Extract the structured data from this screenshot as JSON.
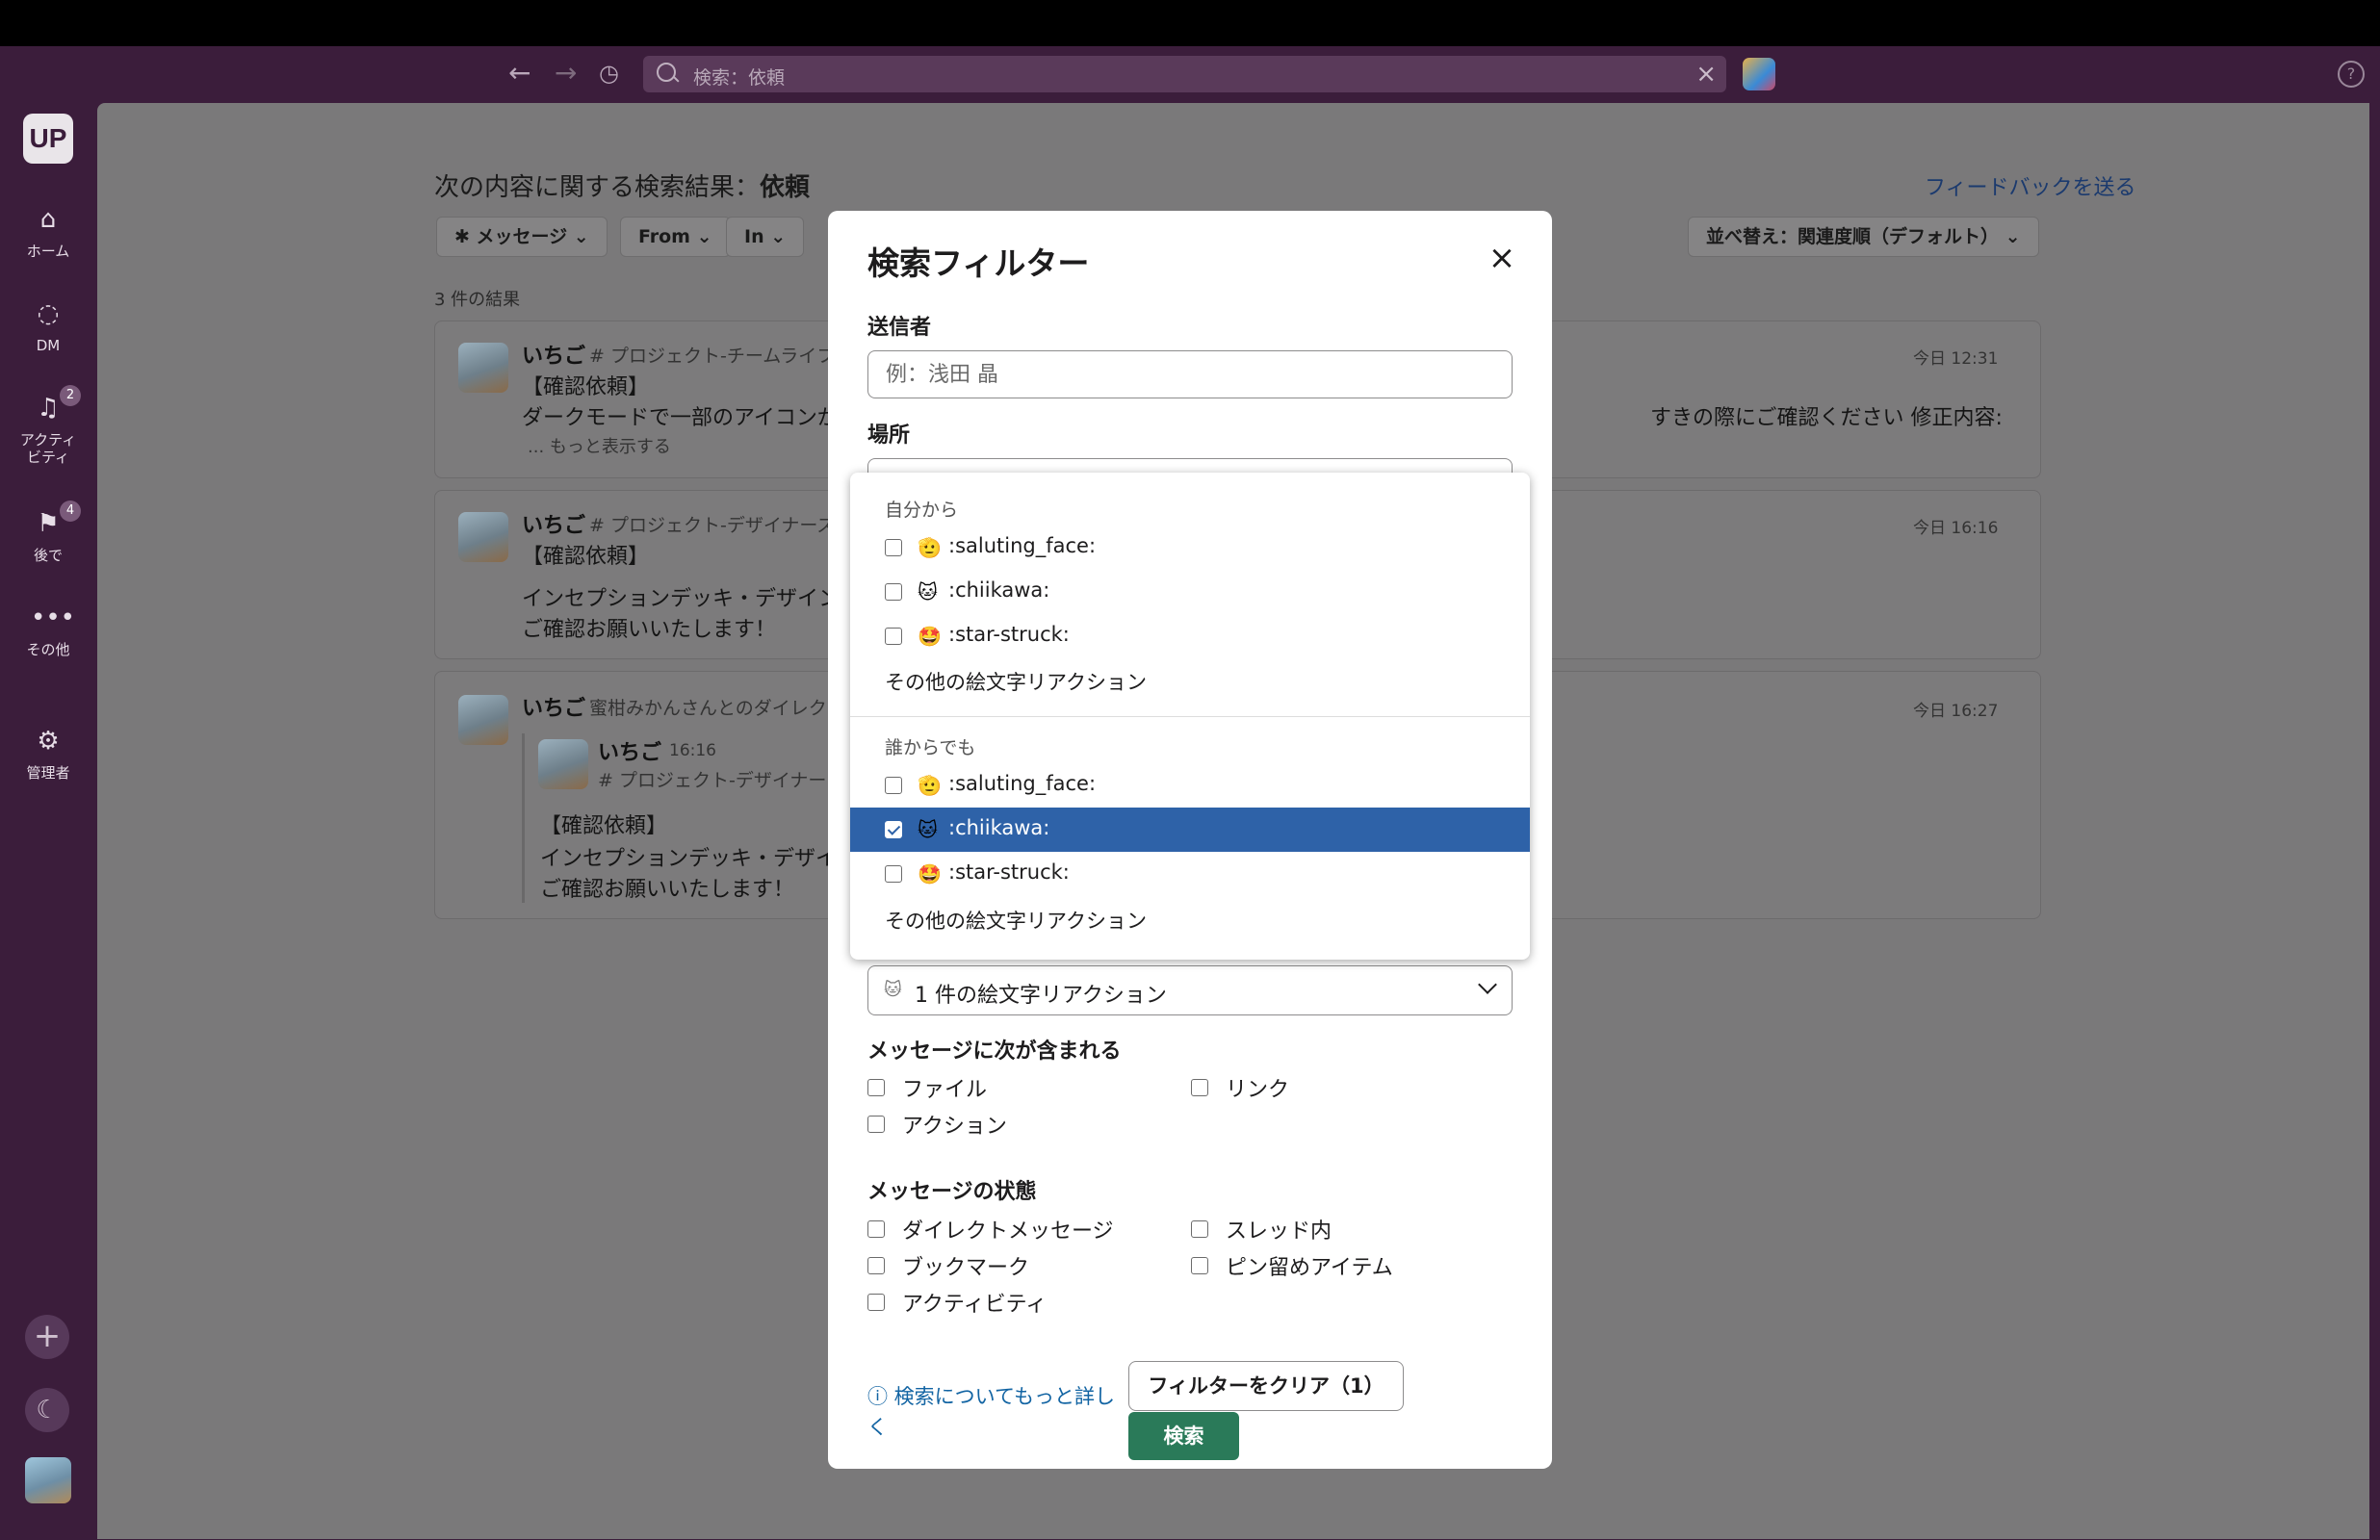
{
  "search": {
    "query": "検索：依頼"
  },
  "sidebar": {
    "workspace": "UP",
    "items": [
      {
        "label": "ホーム",
        "icon": "home-icon"
      },
      {
        "label": "DM",
        "icon": "dm-icon"
      },
      {
        "label": "アクティ\nビティ",
        "icon": "bell-icon",
        "badge": "2"
      },
      {
        "label": "後で",
        "icon": "bookmark-icon",
        "badge": "4"
      },
      {
        "label": "その他",
        "icon": "more-icon"
      },
      {
        "label": "管理者",
        "icon": "gear-icon"
      }
    ]
  },
  "main": {
    "title_prefix": "次の内容に関する検索結果：",
    "title_query": "依頼",
    "feedback": "フィードバックを送る",
    "filters": {
      "messages": "メッセージ",
      "from": "From",
      "in": "In",
      "sort": "並べ替え：関連度順（デフォルト）"
    },
    "count": "3 件の結果",
    "results": [
      {
        "name": "いちご",
        "channel": "# プロジェクト-チームライフ",
        "time": "今日 12:31",
        "line1": "【確認依頼】",
        "line2": "ダークモードで一部のアイコンが",
        "line2b": "すきの際にご確認ください 修正内容:",
        "more": "... もっと表示する"
      },
      {
        "name": "いちご",
        "channel": "# プロジェクト-デザイナーズ",
        "time": "今日 16:16",
        "line1": "【確認依頼】",
        "line2": "インセプションデッキ・デザイン",
        "line3": "ご確認お願いいたします！"
      },
      {
        "name": "いちご",
        "channel": "蜜柑みかんさんとのダイレク",
        "time": "今日 16:27",
        "inner_name": "いちご",
        "inner_time": "16:16",
        "inner_channel": "# プロジェクト-デザイナー",
        "line1": "【確認依頼】",
        "line2": "インセプションデッキ・デザイ",
        "line3": "ご確認お願いいたします！"
      }
    ]
  },
  "modal": {
    "title": "検索フィルター",
    "sender_label": "送信者",
    "sender_placeholder": "例：浅田 晶",
    "location_label": "場所",
    "reaction_value": "1 件の絵文字リアクション",
    "contains_label": "メッセージに次が含まれる",
    "contains": {
      "file": "ファイル",
      "link": "リンク",
      "action": "アクション"
    },
    "status_label": "メッセージの状態",
    "status": {
      "dm": "ダイレクトメッセージ",
      "thread": "スレッド内",
      "bookmark": "ブックマーク",
      "pinned": "ピン留めアイテム",
      "activity": "アクティビティ"
    },
    "learn_more_1": "ⓘ 検索についてもっと詳し",
    "learn_more_2": "く",
    "clear_button": "フィルターをクリア（1）",
    "search_button": "検索"
  },
  "reaction_dropdown": {
    "from_me_header": "自分から",
    "from_me": [
      {
        "label": ":saluting_face:",
        "emoji": "🫡",
        "checked": false
      },
      {
        "label": ":chiikawa:",
        "emoji": "🐱",
        "checked": false
      },
      {
        "label": ":star-struck:",
        "emoji": "🤩",
        "checked": false
      }
    ],
    "from_me_more": "その他の絵文字リアクション",
    "anyone_header": "誰からでも",
    "anyone": [
      {
        "label": ":saluting_face:",
        "emoji": "🫡",
        "checked": false
      },
      {
        "label": ":chiikawa:",
        "emoji": "🐱",
        "checked": true
      },
      {
        "label": ":star-struck:",
        "emoji": "🤩",
        "checked": false
      }
    ],
    "anyone_more": "その他の絵文字リアクション"
  },
  "colors": {
    "sidebar": "#3b1d3b",
    "selected_row": "#2e62a8",
    "search_button": "#2a7a59",
    "link": "#1264a3"
  }
}
